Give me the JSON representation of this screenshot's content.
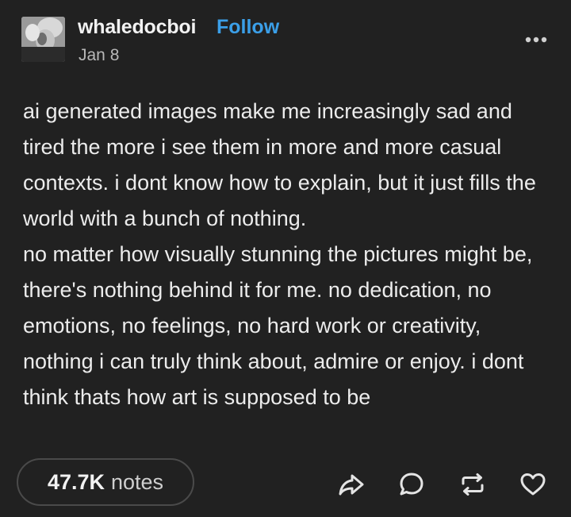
{
  "post": {
    "username": "whaledocboi",
    "follow_label": "Follow",
    "date": "Jan 8",
    "paragraphs": [
      "ai generated images make me increasingly sad and tired the more i see them in more and more casual contexts. i dont know how to explain, but it just fills the world with a bunch of nothing.",
      "no matter how visually stunning the pictures might be, there's nothing behind it for me. no dedication, no emotions, no feelings, no hard work or creativity, nothing i can truly think about, admire or enjoy. i dont think thats how art is supposed to be"
    ]
  },
  "footer": {
    "notes_count": "47.7K",
    "notes_label": "notes",
    "actions": [
      "share-icon",
      "reply-icon",
      "reblog-icon",
      "like-icon"
    ]
  },
  "colors": {
    "background": "#212121",
    "text": "#ececec",
    "follow": "#3b9fe8",
    "muted": "#b8b8b8",
    "border": "#4a4a4a"
  }
}
